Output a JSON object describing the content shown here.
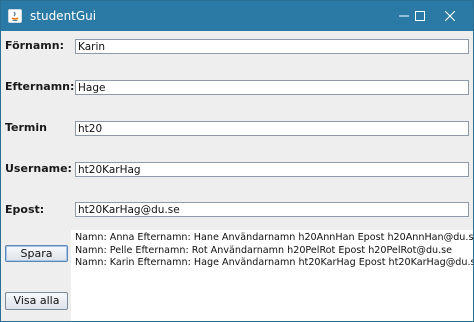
{
  "window": {
    "title": "studentGui",
    "titlebar_color": "#2b7aa6"
  },
  "form": {
    "fornamn": {
      "label": "Förnamn:",
      "value": "Karin"
    },
    "efternamn": {
      "label": "Efternamn:",
      "value": "Hage"
    },
    "termin": {
      "label": "Termin",
      "value": "ht20"
    },
    "username": {
      "label": "Username:",
      "value": "ht20KarHag"
    },
    "epost": {
      "label": "Epost:",
      "value": "ht20KarHag@du.se"
    }
  },
  "buttons": {
    "spara": "Spara",
    "visa_alla": "Visa alla"
  },
  "output": {
    "lines": [
      "Namn: Anna Efternamn: Hane Användarnamn h20AnnHan Epost h20AnnHan@du.se",
      "Namn: Pelle Efternamn: Rot Användarnamn h20PelRot Epost h20PelRot@du.se",
      "Namn: Karin Efternamn: Hage Användarnamn ht20KarHag Epost ht20KarHag@du.se"
    ]
  },
  "icons": {
    "app": "java-app-icon",
    "minimize": "minimize-icon",
    "maximize": "maximize-icon",
    "close": "close-icon"
  }
}
